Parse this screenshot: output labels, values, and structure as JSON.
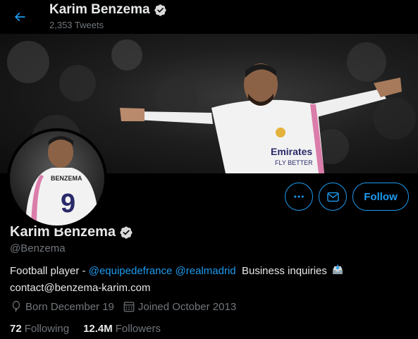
{
  "header": {
    "name": "Karim Benzema",
    "tweets_count": "2,353 Tweets",
    "back_icon": "arrow-left-icon"
  },
  "profile": {
    "display_name": "Karim Benzema",
    "handle": "@Benzema",
    "verified_icon": "verified-badge-icon",
    "avatar_jersey_name": "BENZEMA",
    "avatar_jersey_number": "9",
    "banner_sponsor_line1": "Emirates",
    "banner_sponsor_line2": "FLY BETTER"
  },
  "actions": {
    "more_icon": "more-dots-icon",
    "message_icon": "envelope-icon",
    "follow_label": "Follow"
  },
  "bio": {
    "prefix": "Football player - ",
    "mention1": "@equipedefrance",
    "mention2": "@realmadrid",
    "business": "Business inquiries",
    "email": "contact@benzema-karim.com"
  },
  "meta": {
    "birthday": "Born December 19",
    "joined": "Joined October 2013"
  },
  "stats": {
    "following_count": "72",
    "following_label": "Following",
    "followers_count": "12.4M",
    "followers_label": "Followers"
  },
  "colors": {
    "accent": "#1d9bf0",
    "background": "#000000",
    "text_primary": "#e7e9ea",
    "text_secondary": "#71767b"
  }
}
